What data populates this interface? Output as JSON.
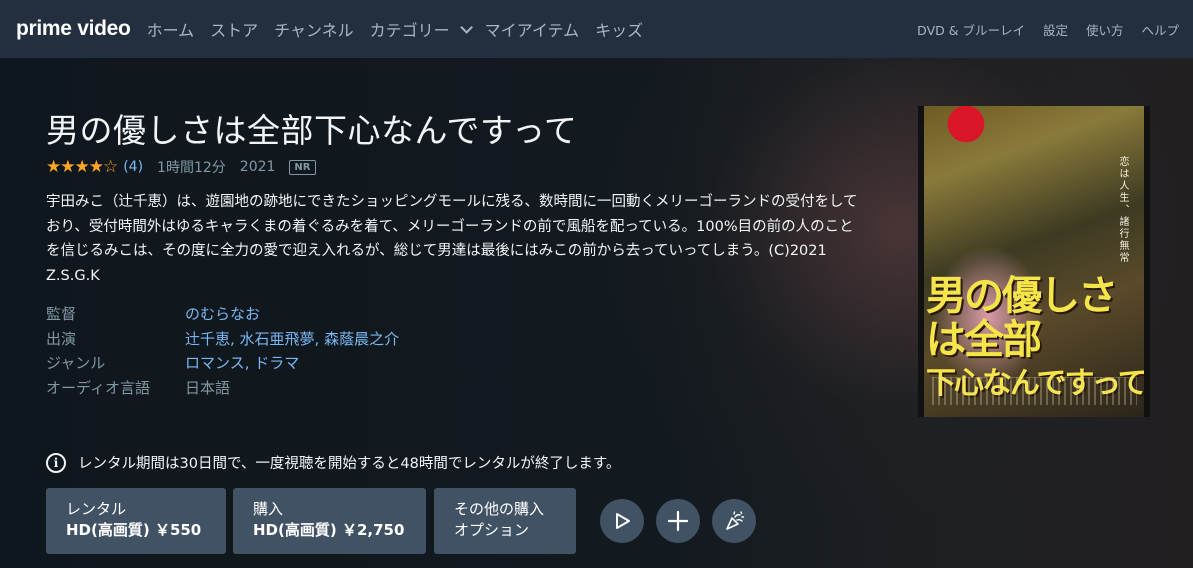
{
  "nav": {
    "logo": "prime video",
    "items": [
      "ホーム",
      "ストア",
      "チャンネル",
      "カテゴリー",
      "マイアイテム",
      "キッズ"
    ],
    "right_items": [
      "DVD & ブルーレイ",
      "設定",
      "使い方",
      "ヘルプ"
    ]
  },
  "movie": {
    "title": "男の優しさは全部下心なんですって",
    "stars": "★★★★☆",
    "rating_count": "(4)",
    "runtime": "1時間12分",
    "year": "2021",
    "rating_badge": "NR",
    "synopsis": "宇田みこ（辻千恵）は、遊園地の跡地にできたショッピングモールに残る、数時間に一回動くメリーゴーランドの受付をしており、受付時間外はゆるキャラくまの着ぐるみを着て、メリーゴーランドの前で風船を配っている。100%目の前の人のことを信じるみこは、その度に全力の愛で迎え入れるが、総じて男達は最後にはみこの前から去っていってしまう。(C)2021 Z.S.G.K"
  },
  "details": {
    "director_label": "監督",
    "director": "のむらなお",
    "cast_label": "出演",
    "cast": "辻千恵, 水石亜飛夢, 森蔭晨之介",
    "genre_label": "ジャンル",
    "genre": "ロマンス, ドラマ",
    "audio_label": "オーディオ言語",
    "audio": "日本語"
  },
  "poster": {
    "title_line1": "男の優しさは全部",
    "title_line2": "下心なんですって",
    "tagline": "恋は人生、諸行無常"
  },
  "notice": {
    "icon": "info-icon",
    "text": "レンタル期間は30日間で、一度視聴を開始すると48時間でレンタルが終了します。"
  },
  "buttons": {
    "rent_line1": "レンタル",
    "rent_line2": "HD(高画質) ￥550",
    "buy_line1": "購入",
    "buy_line2": "HD(高画質) ￥2,750",
    "other_line1": "その他の購入",
    "other_line2": "オプション"
  },
  "colors": {
    "nav_bg": "#232f3e",
    "page_bg": "#0f171e",
    "button_bg": "#425265",
    "link": "#79b8f3",
    "star": "#ffa724"
  }
}
